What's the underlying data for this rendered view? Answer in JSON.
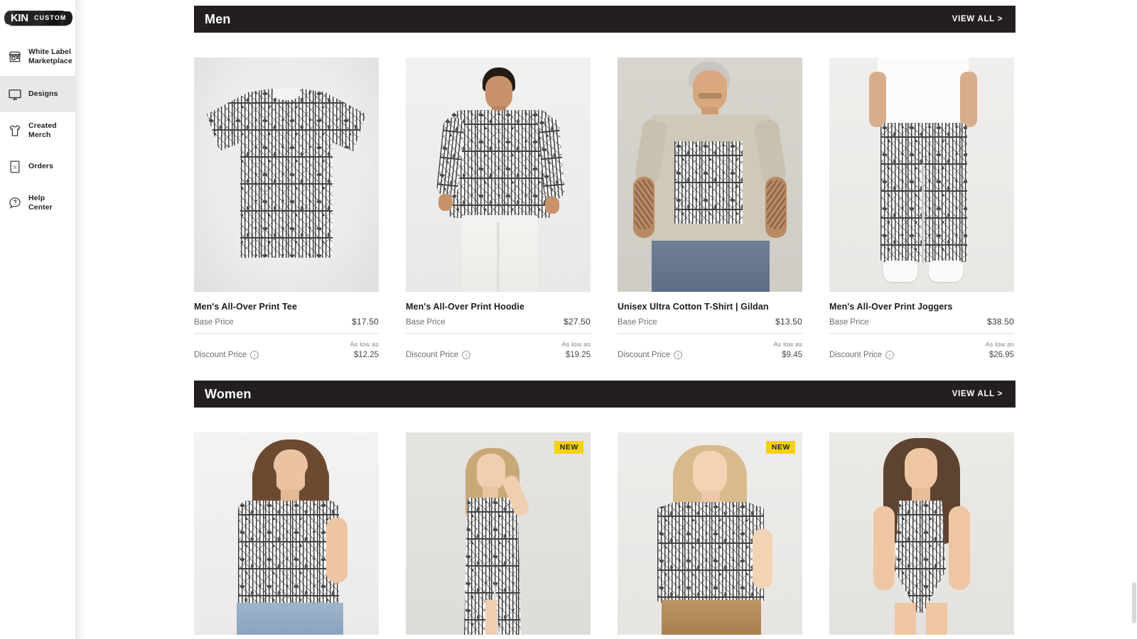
{
  "brand": {
    "logo_primary": "KIN",
    "logo_secondary": "CUSTOM",
    "logo_icon": "kincustom-logo"
  },
  "sidebar": {
    "items": [
      {
        "id": "white-label-marketplace",
        "label": "White Label\nMarketplace",
        "icon": "storefront-icon",
        "active": false
      },
      {
        "id": "designs",
        "label": "Designs",
        "icon": "monitor-icon",
        "active": true
      },
      {
        "id": "created-merch",
        "label": "Created Merch",
        "icon": "tshirt-icon",
        "active": false
      },
      {
        "id": "orders",
        "label": "Orders",
        "icon": "receipt-icon",
        "active": false
      },
      {
        "id": "help-center",
        "label": "Help Center",
        "icon": "question-bubble-icon",
        "active": false
      }
    ]
  },
  "labels": {
    "base_price": "Base Price",
    "discount_price": "Discount Price",
    "as_low_as": "As low as",
    "view_all": "VIEW ALL >",
    "new_badge": "NEW",
    "info_icon": "info-icon",
    "color_wheel_icon": "color-wheel-icon"
  },
  "colors": {
    "section_bar": "#231f20",
    "badge_new": "#f5d20b",
    "tile_background": "#ececec",
    "sidebar_active": "#e8e8e8",
    "divider": "#dedede"
  },
  "sections": [
    {
      "id": "men",
      "title": "Men",
      "view_all": "VIEW ALL >",
      "products": [
        {
          "id": "mens-all-over-print-tee",
          "title": "Men's All-Over Print Tee",
          "base_price": "$17.50",
          "discount_price": "$12.25",
          "has_color_wheel": false,
          "is_new": false,
          "art": "flatlay-tee"
        },
        {
          "id": "mens-all-over-print-hoodie",
          "title": "Men's All-Over Print Hoodie",
          "base_price": "$27.50",
          "discount_price": "$19.25",
          "has_color_wheel": false,
          "is_new": false,
          "art": "male-model-hoodie"
        },
        {
          "id": "unisex-ultra-cotton-t-shirt-gildan",
          "title": "Unisex Ultra Cotton T-Shirt  |  Gildan",
          "base_price": "$13.50",
          "discount_price": "$9.45",
          "has_color_wheel": true,
          "is_new": false,
          "art": "male-model-tan-tee"
        },
        {
          "id": "mens-all-over-print-joggers",
          "title": "Men's All-Over Print Joggers",
          "base_price": "$38.50",
          "discount_price": "$26.95",
          "has_color_wheel": false,
          "is_new": false,
          "art": "male-model-joggers"
        }
      ]
    },
    {
      "id": "women",
      "title": "Women",
      "view_all": "VIEW ALL >",
      "products": [
        {
          "id": "womens-all-over-print-tee",
          "title": "",
          "base_price": "",
          "discount_price": "",
          "has_color_wheel": false,
          "is_new": false,
          "art": "female-model-tee"
        },
        {
          "id": "womens-all-over-print-maxi-dress",
          "title": "",
          "base_price": "",
          "discount_price": "",
          "has_color_wheel": false,
          "is_new": true,
          "art": "female-model-maxi-dress"
        },
        {
          "id": "womens-all-over-print-top",
          "title": "",
          "base_price": "",
          "discount_price": "",
          "has_color_wheel": false,
          "is_new": true,
          "art": "female-model-top"
        },
        {
          "id": "womens-all-over-print-swimsuit",
          "title": "",
          "base_price": "",
          "discount_price": "",
          "has_color_wheel": false,
          "is_new": false,
          "art": "female-model-swimsuit"
        }
      ]
    }
  ]
}
